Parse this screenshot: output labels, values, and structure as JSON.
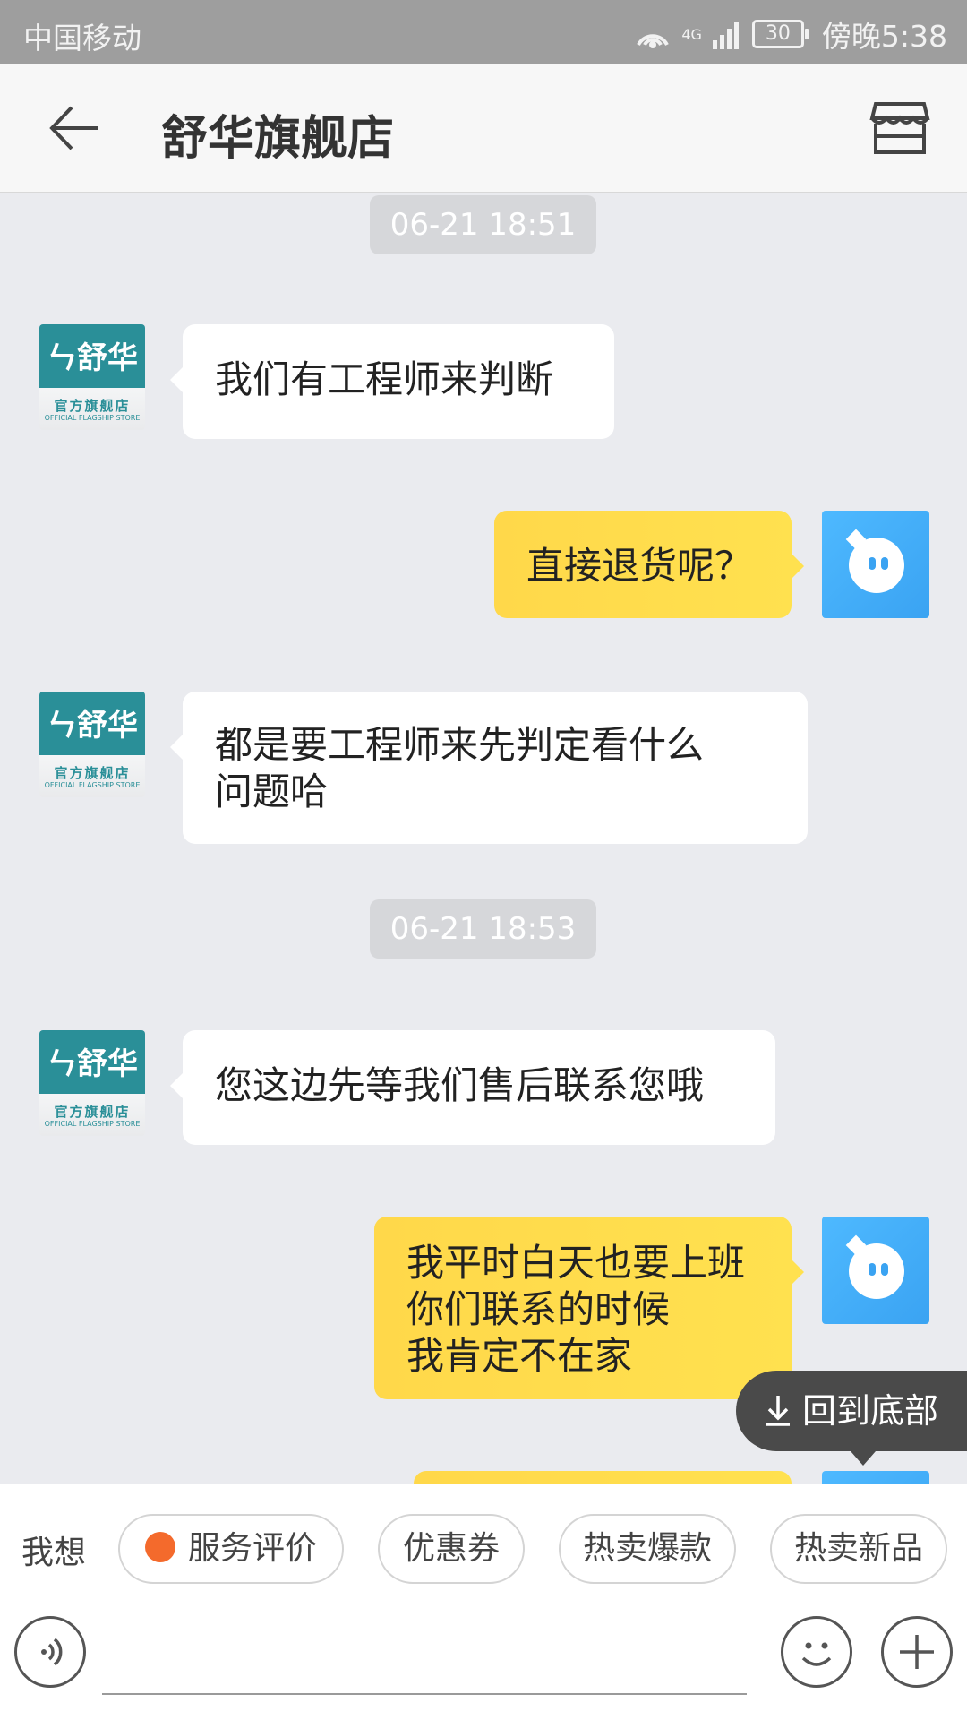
{
  "status_bar": {
    "carrier": "中国移动",
    "signal": "4G",
    "battery": "30",
    "time": "傍晚5:38"
  },
  "header": {
    "title": "舒华旗舰店",
    "back_icon": "back-arrow-icon",
    "store_icon": "store-icon"
  },
  "chat": {
    "timestamps": [
      "06-21 18:51",
      "06-21 18:53"
    ],
    "store_avatar": {
      "brand": "ㄣ舒华",
      "line1": "官方旗舰店",
      "line2": "OFFICIAL FLAGSHIP STORE"
    },
    "messages": [
      {
        "from": "store",
        "text": "我们有工程师来判断"
      },
      {
        "from": "user",
        "text": "直接退货呢？"
      },
      {
        "from": "store",
        "text": "都是要工程师来先判定看什么\n问题哈"
      },
      {
        "from": "store",
        "text": "您这边先等我们售后联系您哦"
      },
      {
        "from": "user",
        "text": "我平时白天也要上班\n你们联系的时候\n我肯定不在家"
      }
    ],
    "scroll_to_bottom": "回到底部"
  },
  "bottom": {
    "want_label": "我想",
    "chips": [
      "服务评价",
      "优惠券",
      "热卖爆款",
      "热卖新品"
    ],
    "voice_icon": "voice-icon",
    "emoji_icon": "emoji-icon",
    "plus_icon": "plus-icon",
    "input_value": ""
  }
}
